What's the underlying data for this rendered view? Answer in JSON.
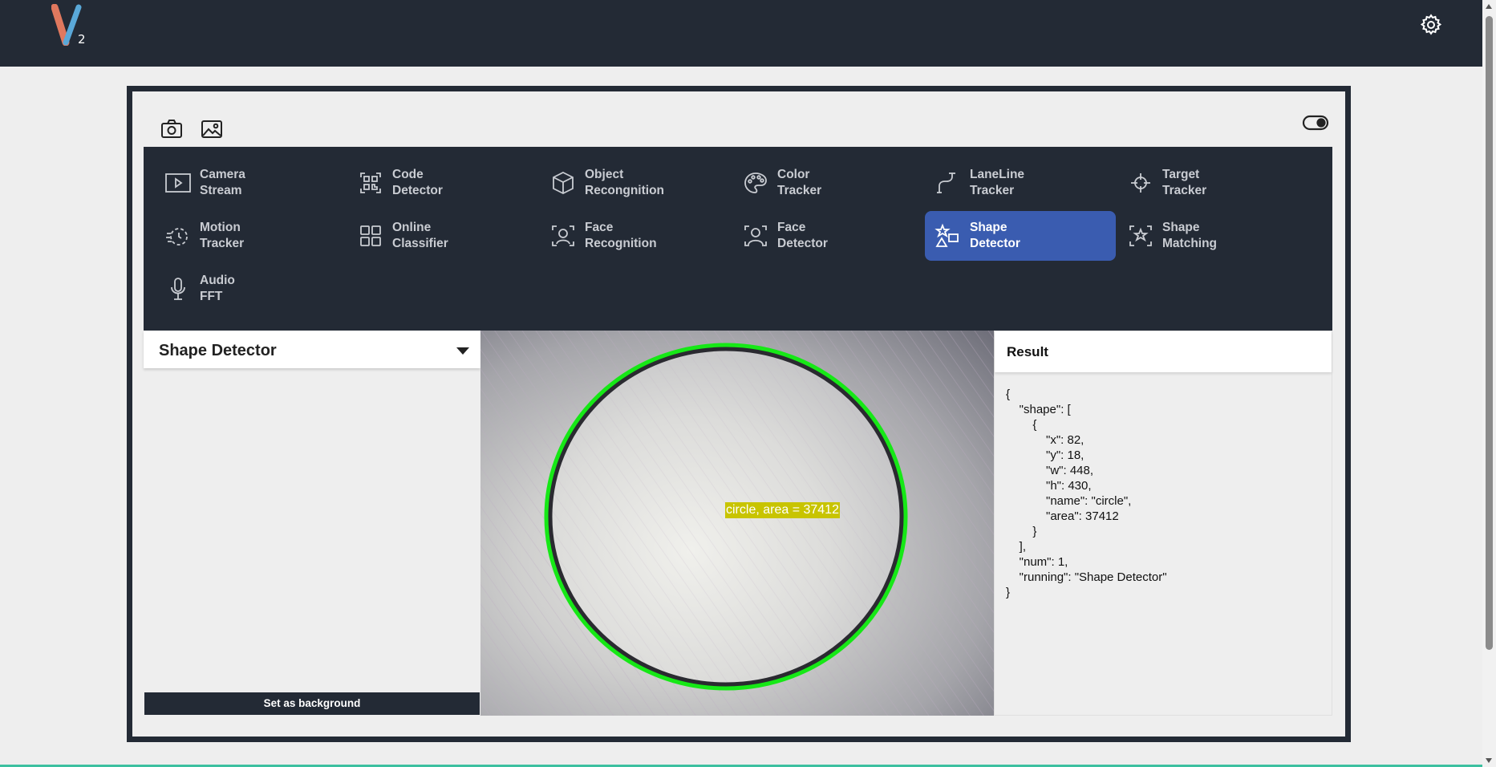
{
  "app": {
    "logo_text": "V",
    "logo_sub": "2"
  },
  "toolbar": {
    "camera_icon": "camera-icon",
    "image_icon": "image-icon",
    "toggle_icon": "toggle-icon"
  },
  "menu": {
    "items": [
      {
        "line1": "Camera",
        "line2": "Stream",
        "icon": "play-icon",
        "active": false
      },
      {
        "line1": "Code",
        "line2": "Detector",
        "icon": "qr-icon",
        "active": false
      },
      {
        "line1": "Object",
        "line2": "Recongnition",
        "icon": "cube-icon",
        "active": false
      },
      {
        "line1": "Color",
        "line2": "Tracker",
        "icon": "palette-icon",
        "active": false
      },
      {
        "line1": "LaneLine",
        "line2": "Tracker",
        "icon": "laneline-icon",
        "active": false
      },
      {
        "line1": "Target",
        "line2": "Tracker",
        "icon": "crosshair-icon",
        "active": false
      },
      {
        "line1": "Motion",
        "line2": "Tracker",
        "icon": "motion-icon",
        "active": false
      },
      {
        "line1": "Online",
        "line2": "Classifier",
        "icon": "grid-icon",
        "active": false
      },
      {
        "line1": "Face",
        "line2": "Recognition",
        "icon": "face-recognition-icon",
        "active": false
      },
      {
        "line1": "Face",
        "line2": "Detector",
        "icon": "face-detector-icon",
        "active": false
      },
      {
        "line1": "Shape",
        "line2": "Detector",
        "icon": "shapes-icon",
        "active": true
      },
      {
        "line1": "Shape",
        "line2": "Matching",
        "icon": "star-icon",
        "active": false
      },
      {
        "line1": "Audio",
        "line2": "FFT",
        "icon": "microphone-icon",
        "active": false
      }
    ]
  },
  "left_panel": {
    "title": "Shape Detector",
    "button_label": "Set as background"
  },
  "camera": {
    "overlay_label": "circle, area = 37412",
    "detection_color": "#16e816",
    "label_bg": "#c8c400"
  },
  "result": {
    "title": "Result",
    "json_text": "{\n    \"shape\": [\n        {\n            \"x\": 82,\n            \"y\": 18,\n            \"w\": 448,\n            \"h\": 430,\n            \"name\": \"circle\",\n            \"area\": 37412\n        }\n    ],\n    \"num\": 1,\n    \"running\": \"Shape Detector\"\n}"
  },
  "colors": {
    "nav_bg": "#232a35",
    "active_item": "#3a5cb0",
    "page_bg": "#eeeeee"
  }
}
